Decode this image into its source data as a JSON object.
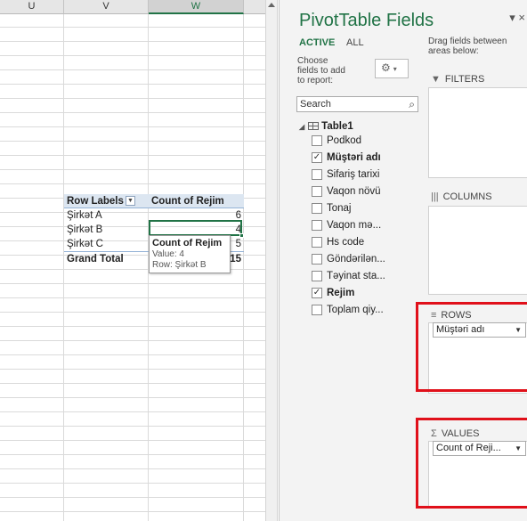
{
  "sheet": {
    "columns": [
      "U",
      "V",
      "W"
    ],
    "pivot": {
      "header_row_labels": "Row Labels",
      "header_value": "Count of Rejim",
      "rows": [
        {
          "label": "Şirkət A",
          "value": "6"
        },
        {
          "label": "Şirkət B",
          "value": "4"
        },
        {
          "label": "Şirkət C",
          "value": "5"
        }
      ],
      "total_label": "Grand Total",
      "total_value": "15"
    },
    "tooltip": {
      "title": "Count of Rejim",
      "value_line": "Value: 4",
      "row_line": "Row: Şirkət B"
    }
  },
  "pane": {
    "title": "PivotTable Fields",
    "close_glyph": "▾ ×",
    "tabs": {
      "active": "ACTIVE",
      "all": "ALL"
    },
    "choose_text": "Choose fields to add to report:",
    "tools_glyph": "⚙",
    "tools_chevron": "▾",
    "search": {
      "value": "Search",
      "icon": "⌕"
    },
    "table_name": "Table1",
    "fields": [
      {
        "label": "Podkod",
        "mark": ""
      },
      {
        "label": "Müştəri adı",
        "mark": "✓"
      },
      {
        "label": "Sifariş tarixi",
        "mark": ""
      },
      {
        "label": "Vaqon növü",
        "mark": ""
      },
      {
        "label": "Tonaj",
        "mark": ""
      },
      {
        "label": "Vaqon mə...",
        "mark": ""
      },
      {
        "label": "Hs code",
        "mark": ""
      },
      {
        "label": "Göndərilən...",
        "mark": ""
      },
      {
        "label": "Təyinat sta...",
        "mark": ""
      },
      {
        "label": "Rejim",
        "mark": "✓"
      },
      {
        "label": "Toplam qiy...",
        "mark": ""
      }
    ],
    "drag_text": "Drag fields between areas below:",
    "areas": {
      "filters": {
        "icon": "▼",
        "label": "FILTERS"
      },
      "columns": {
        "icon": "|||",
        "label": "COLUMNS"
      },
      "rows": {
        "icon": "≡",
        "label": "ROWS",
        "item": "Müştəri adı"
      },
      "values": {
        "icon": "Σ",
        "label": "VALUES",
        "item": "Count of Reji..."
      }
    },
    "dropdown_glyph": "▼",
    "highlight_color": "#e0101a",
    "accent_color": "#217346"
  }
}
